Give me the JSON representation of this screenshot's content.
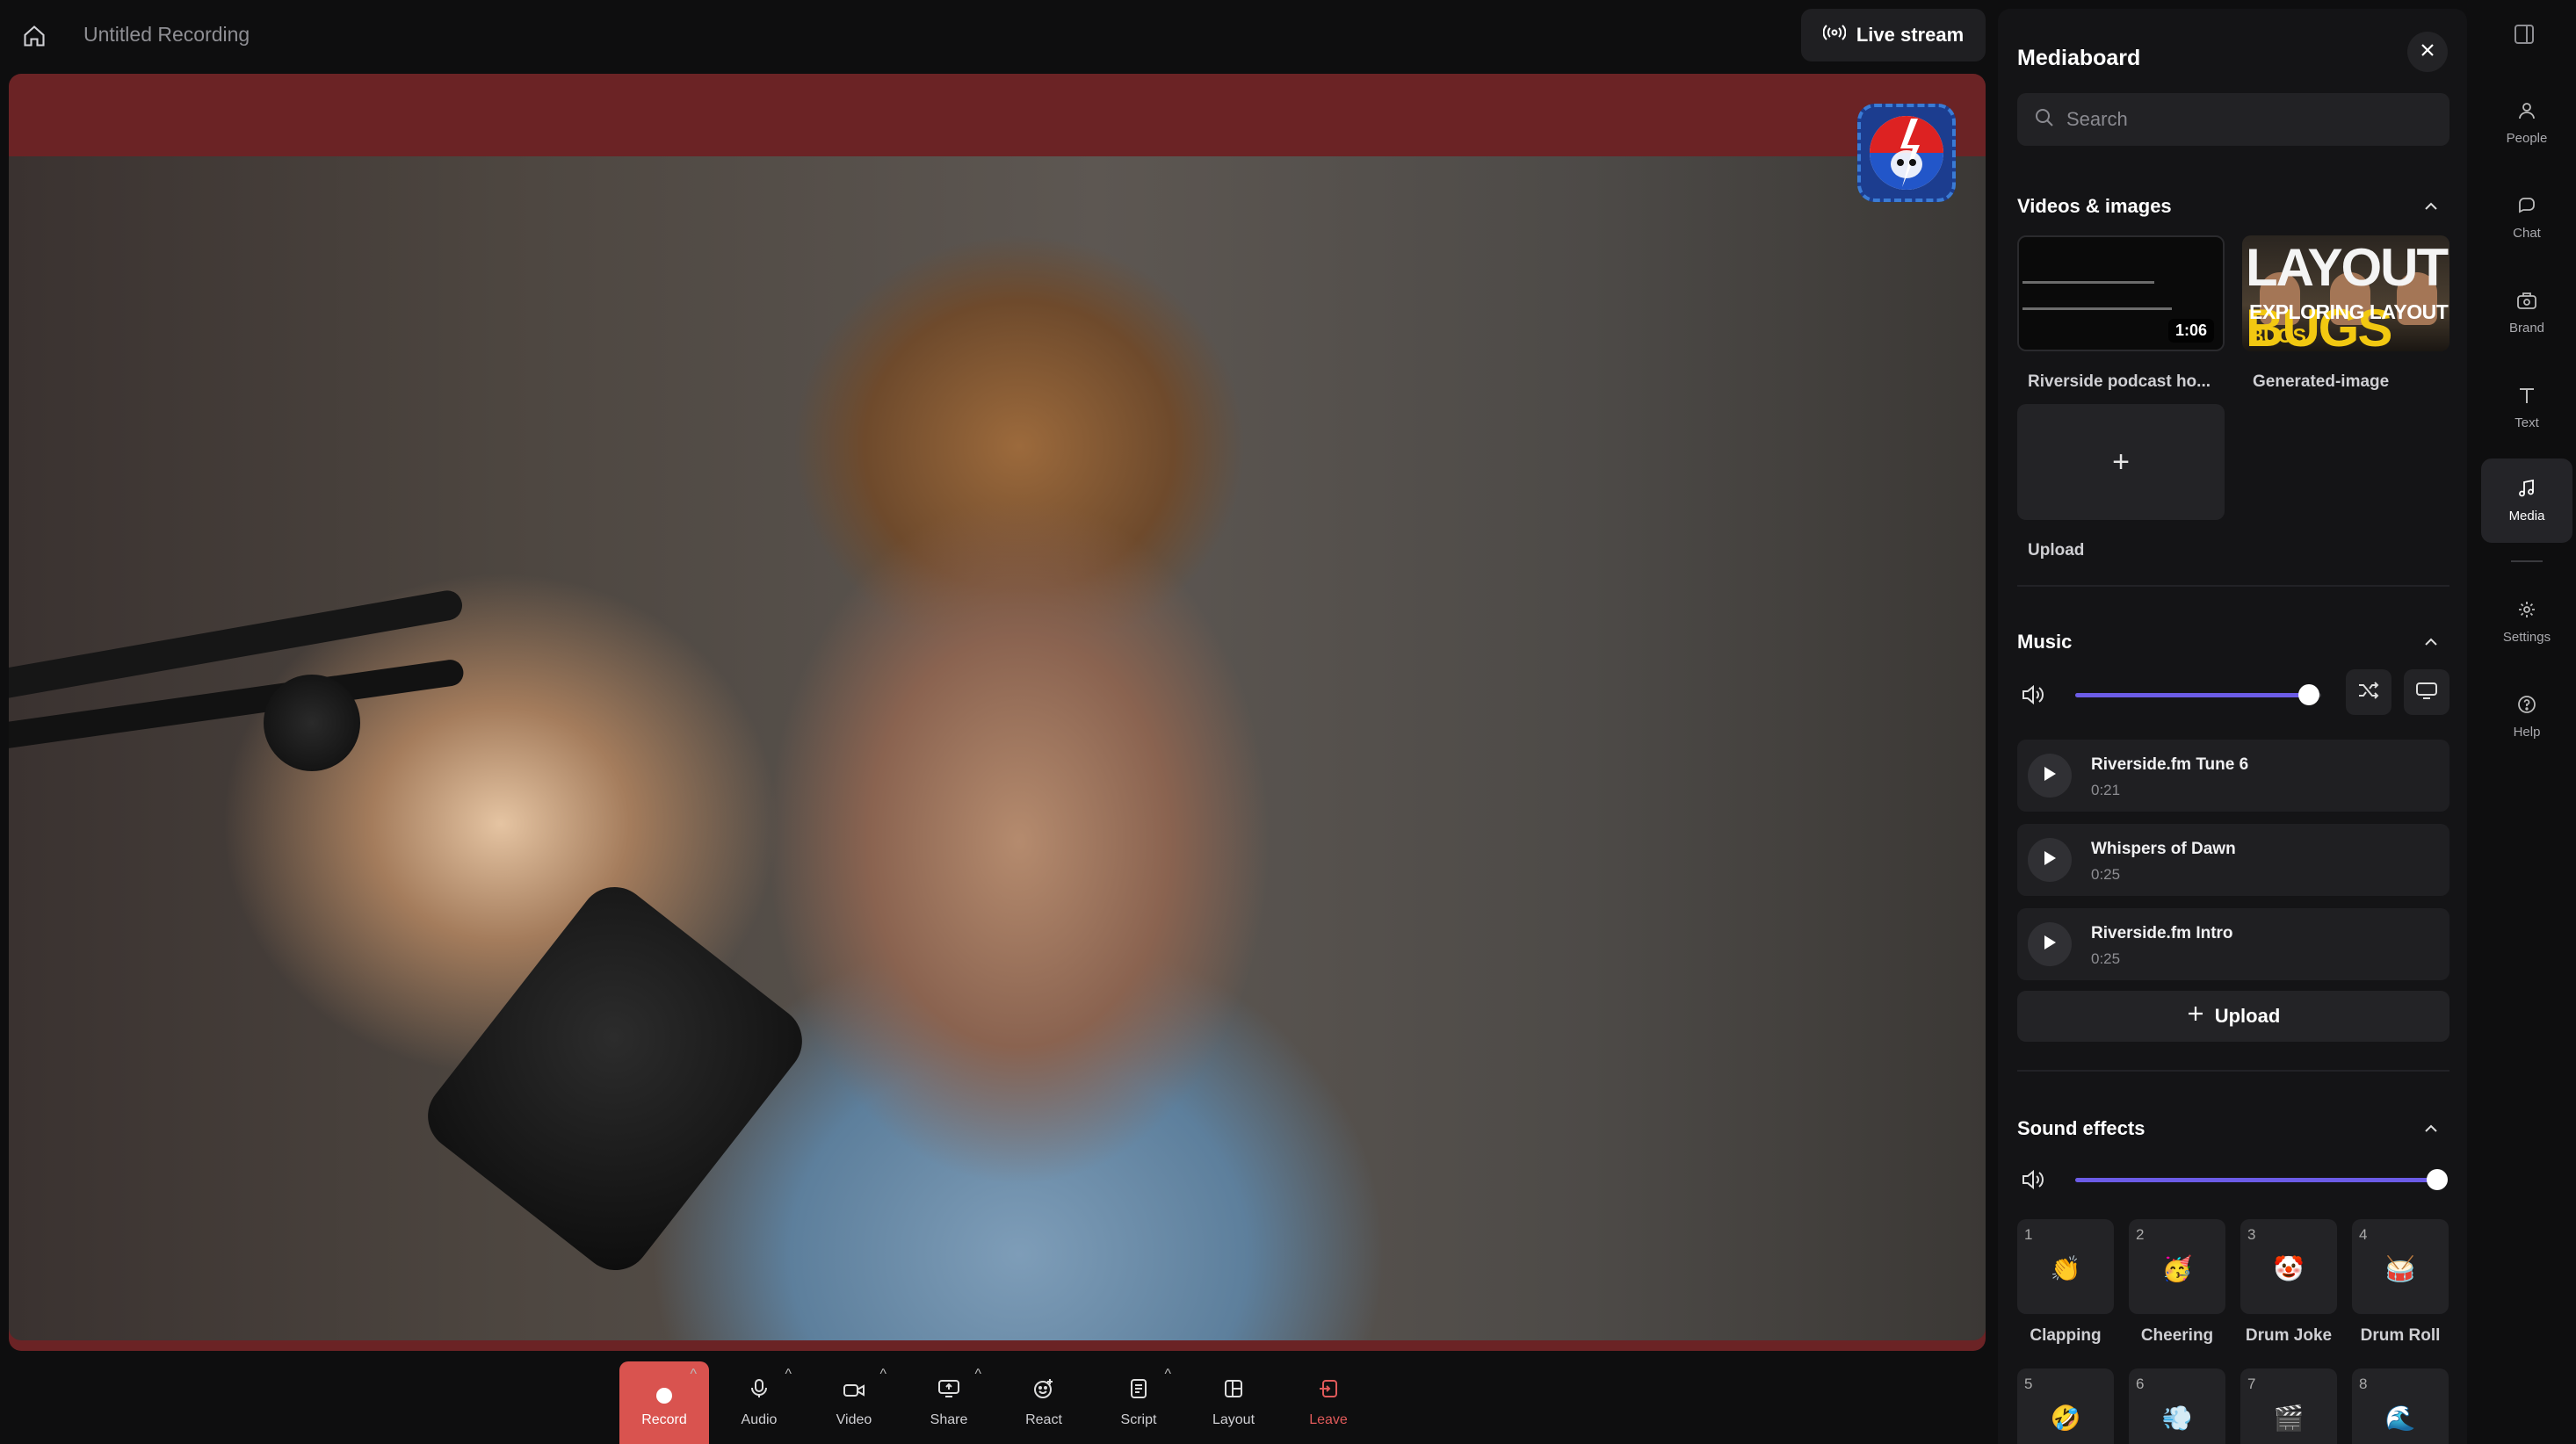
{
  "header": {
    "home_icon": "home-icon",
    "title": "Untitled Recording",
    "live_stream_label": "Live stream",
    "live_icon": "broadcast-icon"
  },
  "stage": {
    "background_color": "#6b2325",
    "logo": "skull-lightning-logo"
  },
  "toolbar": {
    "items": [
      {
        "label": "Record",
        "icon": "record-dot-icon",
        "has_caret": true
      },
      {
        "label": "Audio",
        "icon": "mic-icon",
        "has_caret": true
      },
      {
        "label": "Video",
        "icon": "camera-icon",
        "has_caret": true
      },
      {
        "label": "Share",
        "icon": "share-screen-icon",
        "has_caret": true
      },
      {
        "label": "React",
        "icon": "react-icon",
        "has_caret": false
      },
      {
        "label": "Script",
        "icon": "script-icon",
        "has_caret": true
      },
      {
        "label": "Layout",
        "icon": "layout-icon",
        "has_caret": false
      },
      {
        "label": "Leave",
        "icon": "leave-icon",
        "has_caret": false
      }
    ],
    "record_color": "#d9534f"
  },
  "mediaboard": {
    "title": "Mediaboard",
    "search_placeholder": "Search",
    "videos_images": {
      "heading": "Videos & images",
      "items": [
        {
          "label": "Riverside podcast ho...",
          "duration": "1:06"
        },
        {
          "label": "Generated-image",
          "thumb_text_top_a": "LAYOUT",
          "thumb_text_top_b": "BUGS",
          "thumb_text_bottom_a": "EXPLORING LAYOUT",
          "thumb_text_bottom_b": "BUGS"
        }
      ],
      "upload_label": "Upload",
      "upload_plus": "+"
    },
    "music": {
      "heading": "Music",
      "volume": 0.95,
      "accent": "#6c5ce7",
      "tracks": [
        {
          "name": "Riverside.fm Tune 6",
          "duration": "0:21"
        },
        {
          "name": "Whispers of Dawn",
          "duration": "0:25"
        },
        {
          "name": "Riverside.fm Intro",
          "duration": "0:25"
        }
      ],
      "upload_label": "Upload"
    },
    "sound_effects": {
      "heading": "Sound effects",
      "volume": 1.0,
      "items": [
        {
          "num": "1",
          "emoji": "👏",
          "label": "Clapping"
        },
        {
          "num": "2",
          "emoji": "🥳",
          "label": "Cheering"
        },
        {
          "num": "3",
          "emoji": "🤡",
          "label": "Drum Joke"
        },
        {
          "num": "4",
          "emoji": "🥁",
          "label": "Drum Roll"
        },
        {
          "num": "5",
          "emoji": "🤣",
          "label": ""
        },
        {
          "num": "6",
          "emoji": "💨",
          "label": ""
        },
        {
          "num": "7",
          "emoji": "🎬",
          "label": ""
        },
        {
          "num": "8",
          "emoji": "🌊",
          "label": ""
        }
      ]
    }
  },
  "rail": {
    "items": [
      {
        "label": "People",
        "icon": "people-icon"
      },
      {
        "label": "Chat",
        "icon": "chat-icon"
      },
      {
        "label": "Brand",
        "icon": "brand-icon"
      },
      {
        "label": "Text",
        "icon": "text-icon"
      },
      {
        "label": "Media",
        "icon": "music-note-icon",
        "active": true
      },
      {
        "label": "Settings",
        "icon": "gear-icon"
      },
      {
        "label": "Help",
        "icon": "help-icon"
      }
    ]
  }
}
